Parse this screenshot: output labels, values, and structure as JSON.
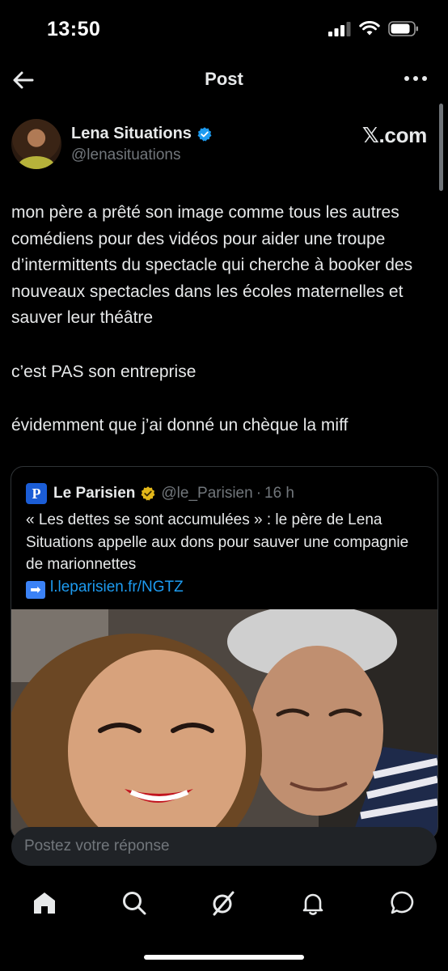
{
  "status_bar": {
    "time": "13:50"
  },
  "nav": {
    "title": "Post"
  },
  "author": {
    "name": "Lena Situations",
    "handle": "@lenasituations"
  },
  "brand": "𝕏.com",
  "post": {
    "paragraphs": [
      "mon père a prêté son image comme tous les autres comédiens pour des vidéos pour aider une troupe d’intermittents du spectacle qui cherche à booker des nouveaux spectacles dans les écoles maternelles et sauver leur théâtre",
      "c’est PAS son entreprise",
      "évidemment que j’ai donné un chèque la miff"
    ]
  },
  "quote": {
    "logo_letter": "P",
    "name": "Le Parisien",
    "handle": "@le_Parisien",
    "separator": "·",
    "time": "16 h",
    "text": "« Les dettes se sont accumulées » : le père de Lena Situations appelle aux dons pour sauver une compagnie de marionnettes",
    "arrow": "➡",
    "link": "l.leparisien.fr/NGTZ"
  },
  "reply": {
    "placeholder": "Postez votre réponse"
  },
  "tabs": [
    "home-icon",
    "search-icon",
    "grok-icon",
    "notifications-icon",
    "messages-icon"
  ],
  "colors": {
    "accent": "#1d9bf0",
    "verified": "#1d9bf0",
    "gold_badge": "#e2b719",
    "background": "#000000"
  }
}
